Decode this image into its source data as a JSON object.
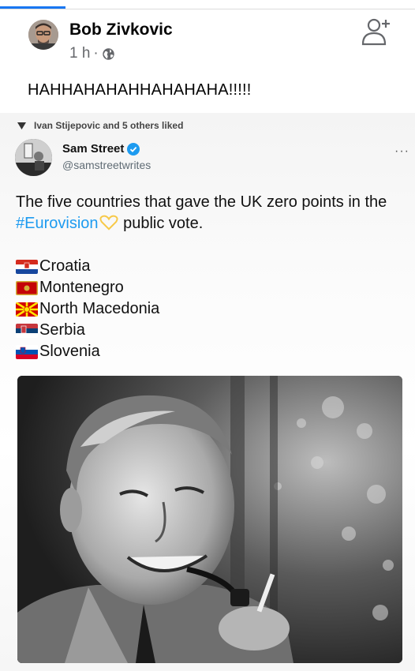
{
  "post": {
    "author": "Bob Zivkovic",
    "time": "1 h",
    "separator": "·",
    "text": "HAHHAHAHAHHAHAHAHA!!!!!",
    "icons": {
      "privacy": "globe-icon",
      "action": "add-friend-icon"
    }
  },
  "tweet": {
    "liked_by": "Ivan Stijepovic and 5 others liked",
    "name": "Sam Street",
    "handle": "@samstreetwrites",
    "more": "···",
    "text_before": "The five countries that gave the UK zero points in the ",
    "hashtag": "#Eurovision",
    "text_after": " public vote.",
    "countries": [
      {
        "name": "Croatia",
        "flag": "croatia-flag-icon"
      },
      {
        "name": "Montenegro",
        "flag": "montenegro-flag-icon"
      },
      {
        "name": "North Macedonia",
        "flag": "north-macedonia-flag-icon"
      },
      {
        "name": "Serbia",
        "flag": "serbia-flag-icon"
      },
      {
        "name": "Slovenia",
        "flag": "slovenia-flag-icon"
      }
    ],
    "photo": "man-in-uniform-smiling-with-pipe"
  },
  "colors": {
    "accent": "#1877f2",
    "hashtag": "#1d9bf0",
    "verified": "#1d9bf0"
  }
}
